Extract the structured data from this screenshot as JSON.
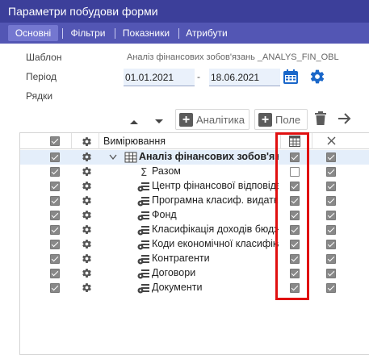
{
  "window": {
    "title": "Параметри побудови форми"
  },
  "tabs": [
    {
      "label": "Основні",
      "active": true
    },
    {
      "label": "Фільтри",
      "active": false
    },
    {
      "label": "Показники",
      "active": false
    },
    {
      "label": "Атрибути",
      "active": false
    }
  ],
  "form": {
    "template_label": "Шаблон",
    "template_value": "Аналіз фінансових зобов'язань _ANALYS_FIN_OBL",
    "period_label": "Період",
    "period_from": "01.01.2021",
    "period_separator": "-",
    "period_to": "18.06.2021",
    "rows_label": "Рядки"
  },
  "toolbar": {
    "analytics_label": "Аналітика",
    "field_label": "Поле"
  },
  "grid": {
    "header": {
      "dimension_label": "Вимірювання"
    },
    "rows": [
      {
        "label": "Аналіз фінансових зобов'язань",
        "bold": true,
        "icon": "table-icon",
        "col1": true,
        "col2": true,
        "col3": true,
        "indent": 0
      },
      {
        "label": "Разом",
        "bold": false,
        "icon": "sigma-icon",
        "col1": true,
        "col2": false,
        "col3": true,
        "indent": 1
      },
      {
        "label": "Центр фінансової відповідальності",
        "bold": false,
        "icon": "dimension-icon",
        "col1": true,
        "col2": true,
        "col3": true,
        "indent": 1
      },
      {
        "label": "Програмна класиф. видатків",
        "bold": false,
        "icon": "dimension-icon",
        "col1": true,
        "col2": true,
        "col3": true,
        "indent": 1
      },
      {
        "label": "Фонд",
        "bold": false,
        "icon": "dimension-icon",
        "col1": true,
        "col2": true,
        "col3": true,
        "indent": 1
      },
      {
        "label": "Класифікація доходів бюджету",
        "bold": false,
        "icon": "dimension-icon",
        "col1": true,
        "col2": true,
        "col3": true,
        "indent": 1
      },
      {
        "label": "Коди економічної класифікації",
        "bold": false,
        "icon": "dimension-icon",
        "col1": true,
        "col2": true,
        "col3": true,
        "indent": 1
      },
      {
        "label": "Контрагенти",
        "bold": false,
        "icon": "dimension-icon",
        "col1": true,
        "col2": true,
        "col3": true,
        "indent": 1
      },
      {
        "label": "Договори",
        "bold": false,
        "icon": "dimension-icon",
        "col1": true,
        "col2": true,
        "col3": true,
        "indent": 1
      },
      {
        "label": "Документи",
        "bold": false,
        "icon": "dimension-icon",
        "col1": true,
        "col2": true,
        "col3": true,
        "indent": 1
      }
    ]
  },
  "colors": {
    "titlebar": "#3c3f9a",
    "tabbar": "#5356b4",
    "active_tab": "#7477d0",
    "selected_row": "#e4eefa",
    "highlight_border": "#e01010",
    "accent_icon": "#1a67c9"
  }
}
